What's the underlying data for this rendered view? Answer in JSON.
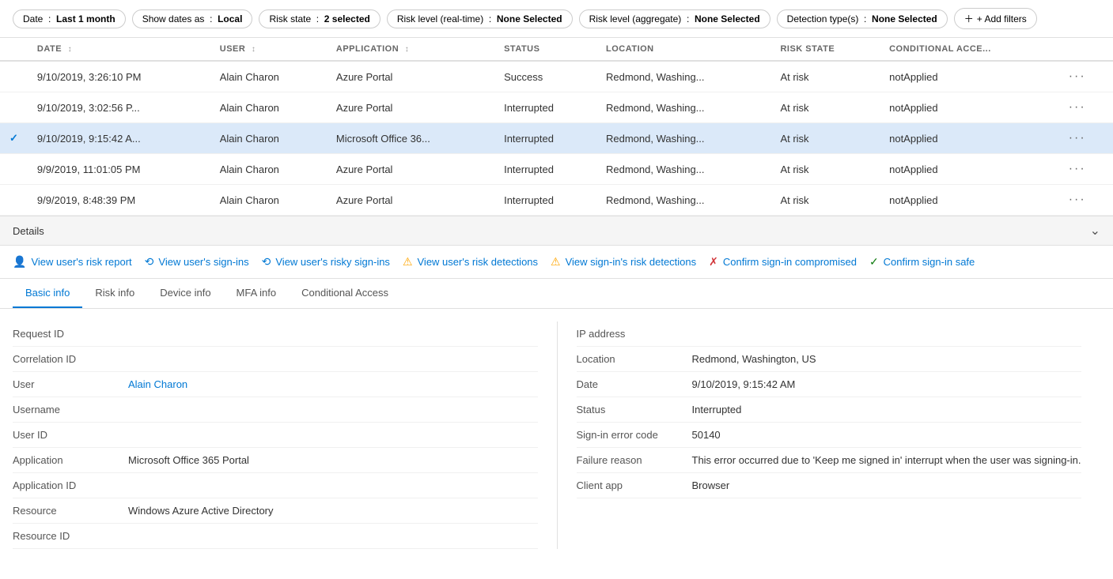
{
  "filters": {
    "date": {
      "label": "Date",
      "value": "Last 1 month"
    },
    "showDates": {
      "label": "Show dates as",
      "value": "Local"
    },
    "riskState": {
      "label": "Risk state",
      "value": "2 selected"
    },
    "riskLevelRealtime": {
      "label": "Risk level (real-time)",
      "value": "None Selected"
    },
    "riskLevelAggregate": {
      "label": "Risk level (aggregate)",
      "value": "None Selected"
    },
    "detectionTypes": {
      "label": "Detection type(s)",
      "value": "None Selected"
    },
    "addFilters": "+ Add filters"
  },
  "table": {
    "columns": [
      {
        "id": "date",
        "label": "DATE",
        "sortable": true
      },
      {
        "id": "user",
        "label": "USER",
        "sortable": true
      },
      {
        "id": "application",
        "label": "APPLICATION",
        "sortable": true
      },
      {
        "id": "status",
        "label": "STATUS"
      },
      {
        "id": "location",
        "label": "LOCATION"
      },
      {
        "id": "riskState",
        "label": "RISK STATE"
      },
      {
        "id": "conditionalAccess",
        "label": "CONDITIONAL ACCE..."
      }
    ],
    "rows": [
      {
        "selected": false,
        "date": "9/10/2019, 3:26:10 PM",
        "user": "Alain Charon",
        "application": "Azure Portal",
        "status": "Success",
        "location": "Redmond, Washing...",
        "riskState": "At risk",
        "conditionalAccess": "notApplied"
      },
      {
        "selected": false,
        "date": "9/10/2019, 3:02:56 P...",
        "user": "Alain Charon",
        "application": "Azure Portal",
        "status": "Interrupted",
        "location": "Redmond, Washing...",
        "riskState": "At risk",
        "conditionalAccess": "notApplied"
      },
      {
        "selected": true,
        "date": "9/10/2019, 9:15:42 A...",
        "user": "Alain Charon",
        "application": "Microsoft Office 36...",
        "status": "Interrupted",
        "location": "Redmond, Washing...",
        "riskState": "At risk",
        "conditionalAccess": "notApplied"
      },
      {
        "selected": false,
        "date": "9/9/2019, 11:01:05 PM",
        "user": "Alain Charon",
        "application": "Azure Portal",
        "status": "Interrupted",
        "location": "Redmond, Washing...",
        "riskState": "At risk",
        "conditionalAccess": "notApplied"
      },
      {
        "selected": false,
        "date": "9/9/2019, 8:48:39 PM",
        "user": "Alain Charon",
        "application": "Azure Portal",
        "status": "Interrupted",
        "location": "Redmond, Washing...",
        "riskState": "At risk",
        "conditionalAccess": "notApplied"
      }
    ]
  },
  "detailsBar": {
    "title": "Details",
    "collapsed": false
  },
  "actions": [
    {
      "id": "risk-report",
      "label": "View user's risk report",
      "icon": "👤",
      "iconColor": "#0078d4"
    },
    {
      "id": "sign-ins",
      "label": "View user's sign-ins",
      "icon": "↩",
      "iconColor": "#0078d4"
    },
    {
      "id": "risky-sign-ins",
      "label": "View user's risky sign-ins",
      "icon": "↩",
      "iconColor": "#0078d4"
    },
    {
      "id": "risk-detections",
      "label": "View user's risk detections",
      "icon": "⚠",
      "iconColor": "#ffa500"
    },
    {
      "id": "signin-risk-detections",
      "label": "View sign-in's risk detections",
      "icon": "⚠",
      "iconColor": "#ffa500"
    },
    {
      "id": "confirm-compromised",
      "label": "Confirm sign-in compromised",
      "icon": "✗",
      "iconColor": "#d13438"
    },
    {
      "id": "confirm-safe",
      "label": "Confirm sign-in safe",
      "icon": "✓",
      "iconColor": "#107c10"
    }
  ],
  "tabs": [
    {
      "id": "basic-info",
      "label": "Basic info",
      "active": true
    },
    {
      "id": "risk-info",
      "label": "Risk info",
      "active": false
    },
    {
      "id": "device-info",
      "label": "Device info",
      "active": false
    },
    {
      "id": "mfa-info",
      "label": "MFA info",
      "active": false
    },
    {
      "id": "conditional-access",
      "label": "Conditional Access",
      "active": false
    }
  ],
  "basicInfo": {
    "left": [
      {
        "label": "Request ID",
        "value": ""
      },
      {
        "label": "Correlation ID",
        "value": ""
      },
      {
        "label": "User",
        "value": "Alain Charon",
        "isLink": true
      },
      {
        "label": "Username",
        "value": ""
      },
      {
        "label": "User ID",
        "value": ""
      },
      {
        "label": "Application",
        "value": "Microsoft Office 365 Portal"
      },
      {
        "label": "Application ID",
        "value": ""
      },
      {
        "label": "Resource",
        "value": "Windows Azure Active Directory"
      },
      {
        "label": "Resource ID",
        "value": ""
      }
    ],
    "right": [
      {
        "label": "IP address",
        "value": ""
      },
      {
        "label": "Location",
        "value": "Redmond, Washington, US"
      },
      {
        "label": "Date",
        "value": "9/10/2019, 9:15:42 AM"
      },
      {
        "label": "Status",
        "value": "Interrupted"
      },
      {
        "label": "Sign-in error code",
        "value": "50140"
      },
      {
        "label": "Failure reason",
        "value": "This error occurred due to 'Keep me signed in' interrupt when the user was signing-in."
      },
      {
        "label": "Client app",
        "value": "Browser"
      }
    ]
  }
}
